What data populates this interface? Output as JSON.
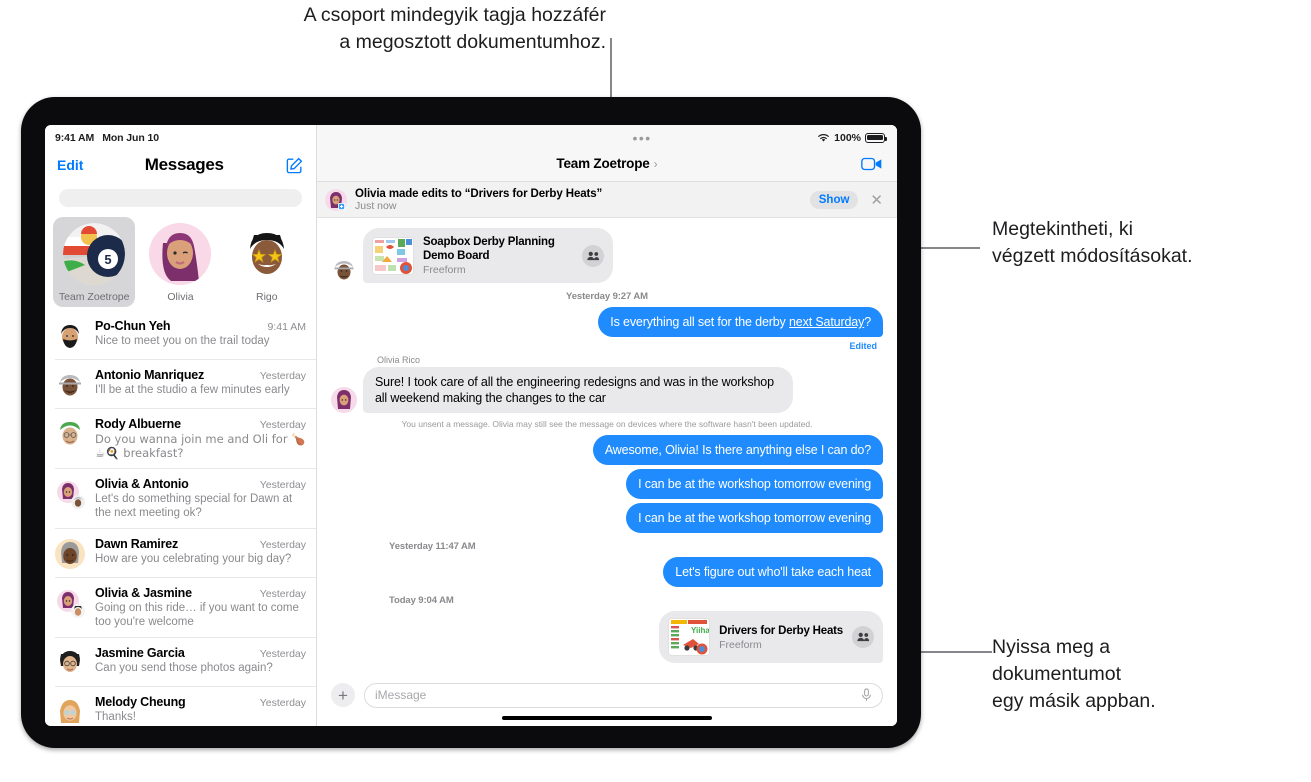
{
  "callouts": {
    "top": "A csoport mindegyik tagja hozzáfér\na megosztott dokumentumhoz.",
    "right_top": "Megtekintheti, ki\nvégzett módosításokat.",
    "right_bottom": "Nyissa meg a\ndokumentumot\negy másik appban."
  },
  "sidebar": {
    "status": {
      "time": "9:41 AM",
      "date": "Mon Jun 10"
    },
    "nav": {
      "edit": "Edit",
      "title": "Messages",
      "compose_icon": "compose-icon"
    },
    "search_placeholder": "",
    "pinned": [
      {
        "label": "Team Zoetrope",
        "selected": true,
        "avatar": "group-zoetrope"
      },
      {
        "label": "Olivia",
        "selected": false,
        "avatar": "memoji-olivia"
      },
      {
        "label": "Rigo",
        "selected": false,
        "avatar": "memoji-rigo"
      }
    ],
    "conversations": [
      {
        "name": "Po-Chun Yeh",
        "time": "9:41 AM",
        "preview": "Nice to meet you on the trail today",
        "avatar": "memoji-pochun"
      },
      {
        "name": "Antonio Manriquez",
        "time": "Yesterday",
        "preview": "I'll be at the studio a few minutes early",
        "avatar": "memoji-antonio"
      },
      {
        "name": "Rody Albuerne",
        "time": "Yesterday",
        "preview": "Do you wanna join me and Oli for 🍗☕🍳 breakfast?",
        "avatar": "memoji-rody"
      },
      {
        "name": "Olivia & Antonio",
        "time": "Yesterday",
        "preview": "Let's do something special for Dawn at the next meeting ok?",
        "avatar": "group-olivia-antonio"
      },
      {
        "name": "Dawn Ramirez",
        "time": "Yesterday",
        "preview": "How are you celebrating your big day?",
        "avatar": "memoji-dawn"
      },
      {
        "name": "Olivia & Jasmine",
        "time": "Yesterday",
        "preview": "Going on this ride… if you want to come too you're welcome",
        "avatar": "group-olivia-jasmine"
      },
      {
        "name": "Jasmine Garcia",
        "time": "Yesterday",
        "preview": "Can you send those photos again?",
        "avatar": "memoji-jasmine"
      },
      {
        "name": "Melody Cheung",
        "time": "Yesterday",
        "preview": "Thanks!",
        "avatar": "memoji-melody"
      }
    ]
  },
  "pane": {
    "status": {
      "wifi": "wifi-icon",
      "battery_pct": "100%"
    },
    "header": {
      "title": "Team Zoetrope",
      "chevron": "chevron-right-icon",
      "facetime_icon": "facetime-video-icon"
    },
    "banner": {
      "title": "Olivia made edits to “Drivers for Derby Heats”",
      "subtitle": "Just now",
      "show_label": "Show",
      "close_icon": "close-icon"
    },
    "messages": [
      {
        "kind": "card",
        "side": "in",
        "avatar": "memoji-antonio",
        "title": "Soapbox Derby Planning Demo Board",
        "subtitle": "Freeform",
        "badge_icon": "people-shared-icon"
      },
      {
        "kind": "stamp",
        "text": "Yesterday 9:27 AM"
      },
      {
        "kind": "text",
        "side": "out",
        "text": "Is everything all set for the derby ",
        "link": "next Saturday",
        "text_tail": "?",
        "edited_label": "Edited"
      },
      {
        "kind": "sender",
        "text": "Olivia Rico"
      },
      {
        "kind": "text",
        "side": "in",
        "avatar": "memoji-olivia",
        "text": "Sure! I took care of all the engineering redesigns and was in the workshop all weekend making the changes to the car"
      },
      {
        "kind": "sysnote",
        "text": "You unsent a message. Olivia may still see the message on devices where the software hasn't been updated."
      },
      {
        "kind": "text",
        "side": "out",
        "text": "Awesome, Olivia! Is there anything else I can do?"
      },
      {
        "kind": "text",
        "side": "out",
        "text": "I can be at the workshop tomorrow evening"
      },
      {
        "kind": "text",
        "side": "out",
        "text": "I can be at the workshop tomorrow evening"
      },
      {
        "kind": "stamp",
        "text": "Yesterday 11:47 AM"
      },
      {
        "kind": "text",
        "side": "out",
        "text": "Let's figure out who'll take each heat"
      },
      {
        "kind": "stamp",
        "text": "Today 9:04 AM"
      },
      {
        "kind": "card",
        "side": "out",
        "title": "Drivers for Derby Heats",
        "subtitle": "Freeform",
        "badge_icon": "people-shared-icon"
      }
    ],
    "composer": {
      "plus_icon": "plus-icon",
      "placeholder": "iMessage",
      "mic_icon": "microphone-icon"
    }
  }
}
